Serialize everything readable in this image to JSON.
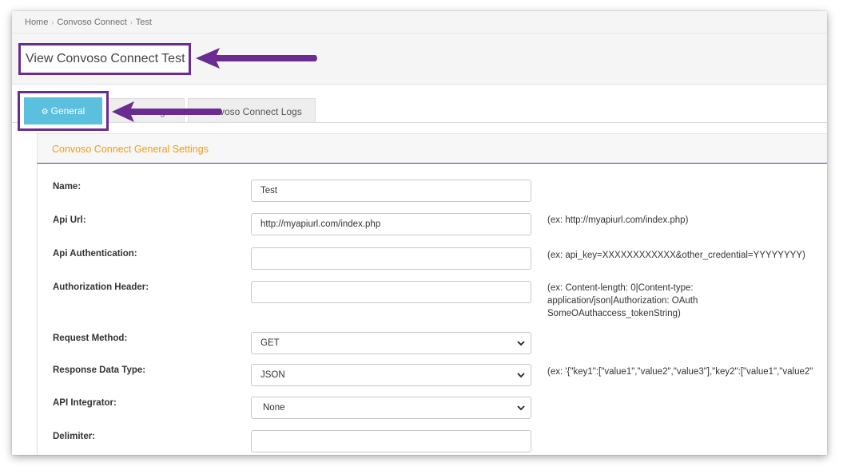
{
  "breadcrumb": [
    "Home",
    "Convoso Connect",
    "Test"
  ],
  "page_title": "View Convoso Connect Test",
  "tabs": {
    "general": "General",
    "second_partial": "g",
    "logs_partial": "voso Connect Logs"
  },
  "panel_title": "Convoso Connect General Settings",
  "fields": {
    "name": {
      "label": "Name:",
      "value": "Test"
    },
    "api_url": {
      "label": "Api Url:",
      "value": "http://myapiurl.com/index.php",
      "hint": "(ex: http://myapiurl.com/index.php)"
    },
    "api_auth": {
      "label": "Api Authentication:",
      "value": "",
      "hint": "(ex: api_key=XXXXXXXXXXXX&other_credential=YYYYYYYY)"
    },
    "auth_header": {
      "label": "Authorization Header:",
      "value": "",
      "hint": [
        "(ex: Content-length: 0|Content-type:",
        "application/json|Authorization: OAuth",
        "SomeOAuthaccess_tokenString)"
      ]
    },
    "request_method": {
      "label": "Request Method:",
      "value": "GET"
    },
    "response_type": {
      "label": "Response Data Type:",
      "value": "JSON",
      "hint": "(ex: '{\"key1\":[\"value1\",\"value2\",\"value3\"],\"key2\":[\"value1\",\"value2\""
    },
    "api_integrator": {
      "label": "API Integrator:",
      "value": "None"
    },
    "delimiter": {
      "label": "Delimiter:",
      "value": ""
    }
  },
  "colors": {
    "accent": "#6a2c91",
    "tab_active": "#5bc0de",
    "panel_title": "#f39c12"
  },
  "icons": {
    "general_tab": "gears-icon",
    "select": "chevron-down-icon",
    "annotation": "arrow-left-icon"
  }
}
